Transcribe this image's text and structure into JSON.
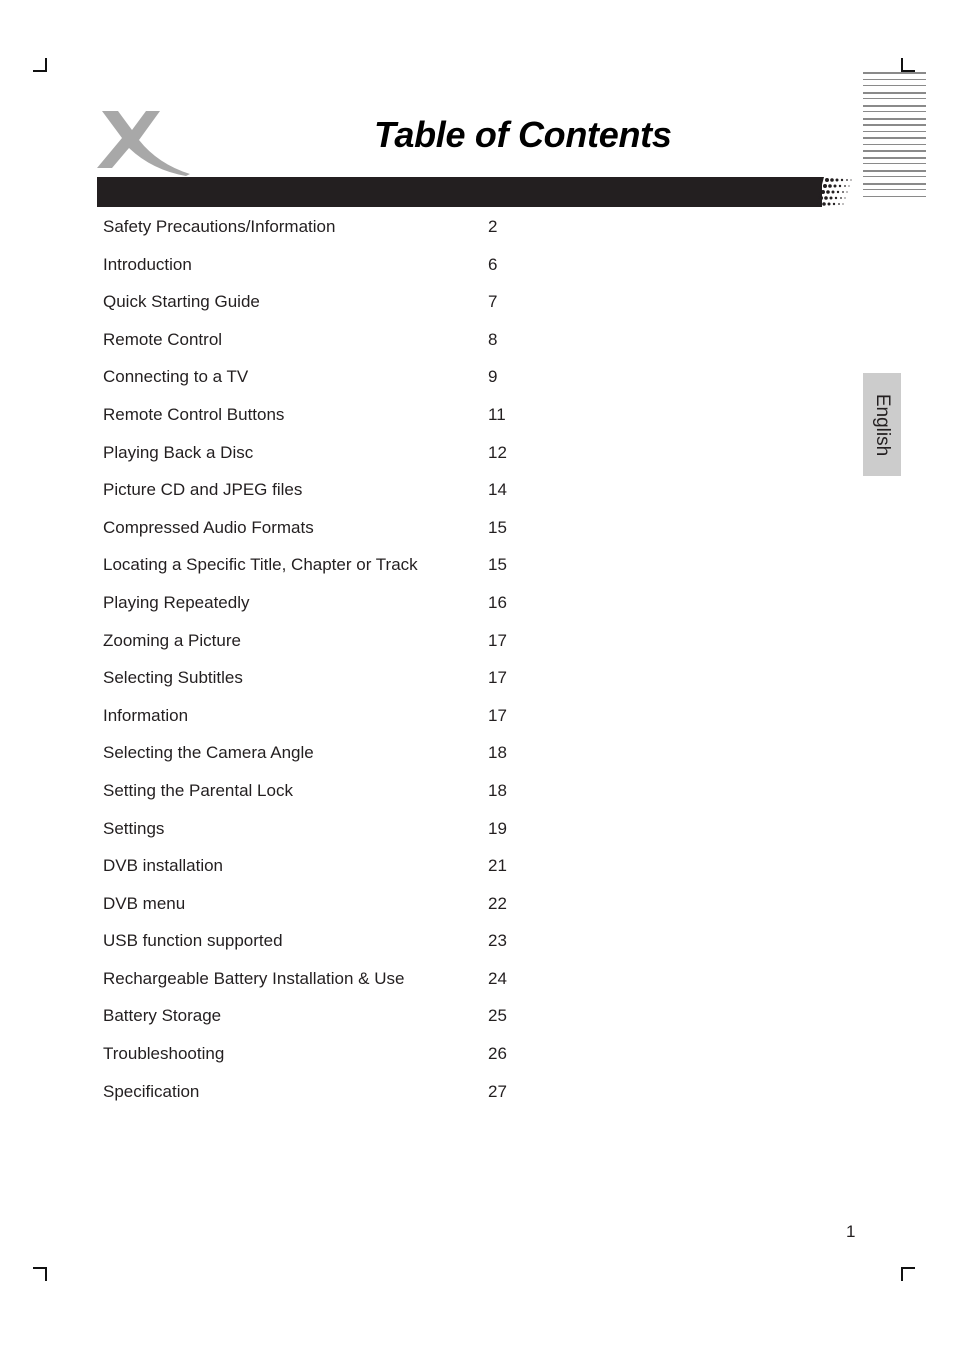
{
  "title": "Table of Contents",
  "language_tab": "English",
  "page_number": "1",
  "toc": [
    {
      "title": "Safety Precautions/Information",
      "page": "2"
    },
    {
      "title": "Introduction",
      "page": "6"
    },
    {
      "title": "Quick Starting Guide",
      "page": "7"
    },
    {
      "title": "Remote Control",
      "page": "8"
    },
    {
      "title": "Connecting to a TV",
      "page": "9"
    },
    {
      "title": "Remote Control Buttons",
      "page": "11"
    },
    {
      "title": "Playing Back a Disc",
      "page": "12"
    },
    {
      "title": "Picture CD and JPEG files",
      "page": "14"
    },
    {
      "title": "Compressed Audio Formats",
      "page": "15"
    },
    {
      "title": "Locating a Specific Title, Chapter or Track",
      "page": "15"
    },
    {
      "title": "Playing Repeatedly",
      "page": "16"
    },
    {
      "title": "Zooming a Picture",
      "page": "17"
    },
    {
      "title": "Selecting Subtitles",
      "page": "17"
    },
    {
      "title": "Information",
      "page": "17"
    },
    {
      "title": "Selecting the Camera Angle",
      "page": "18"
    },
    {
      "title": "Setting the Parental Lock",
      "page": "18"
    },
    {
      "title": "Settings",
      "page": "19"
    },
    {
      "title": "DVB installation",
      "page": "21"
    },
    {
      "title": "DVB menu",
      "page": "22"
    },
    {
      "title": "USB function supported",
      "page": "23"
    },
    {
      "title": "Rechargeable Battery Installation & Use",
      "page": "24"
    },
    {
      "title": "Battery Storage",
      "page": "25"
    },
    {
      "title": "Troubleshooting",
      "page": "26"
    },
    {
      "title": "Specification",
      "page": "27"
    }
  ],
  "colors": {
    "header_bar": "#231f20",
    "logo": "#a8a8a8",
    "language_tab_bg": "#cccccc",
    "text": "#231f20"
  }
}
